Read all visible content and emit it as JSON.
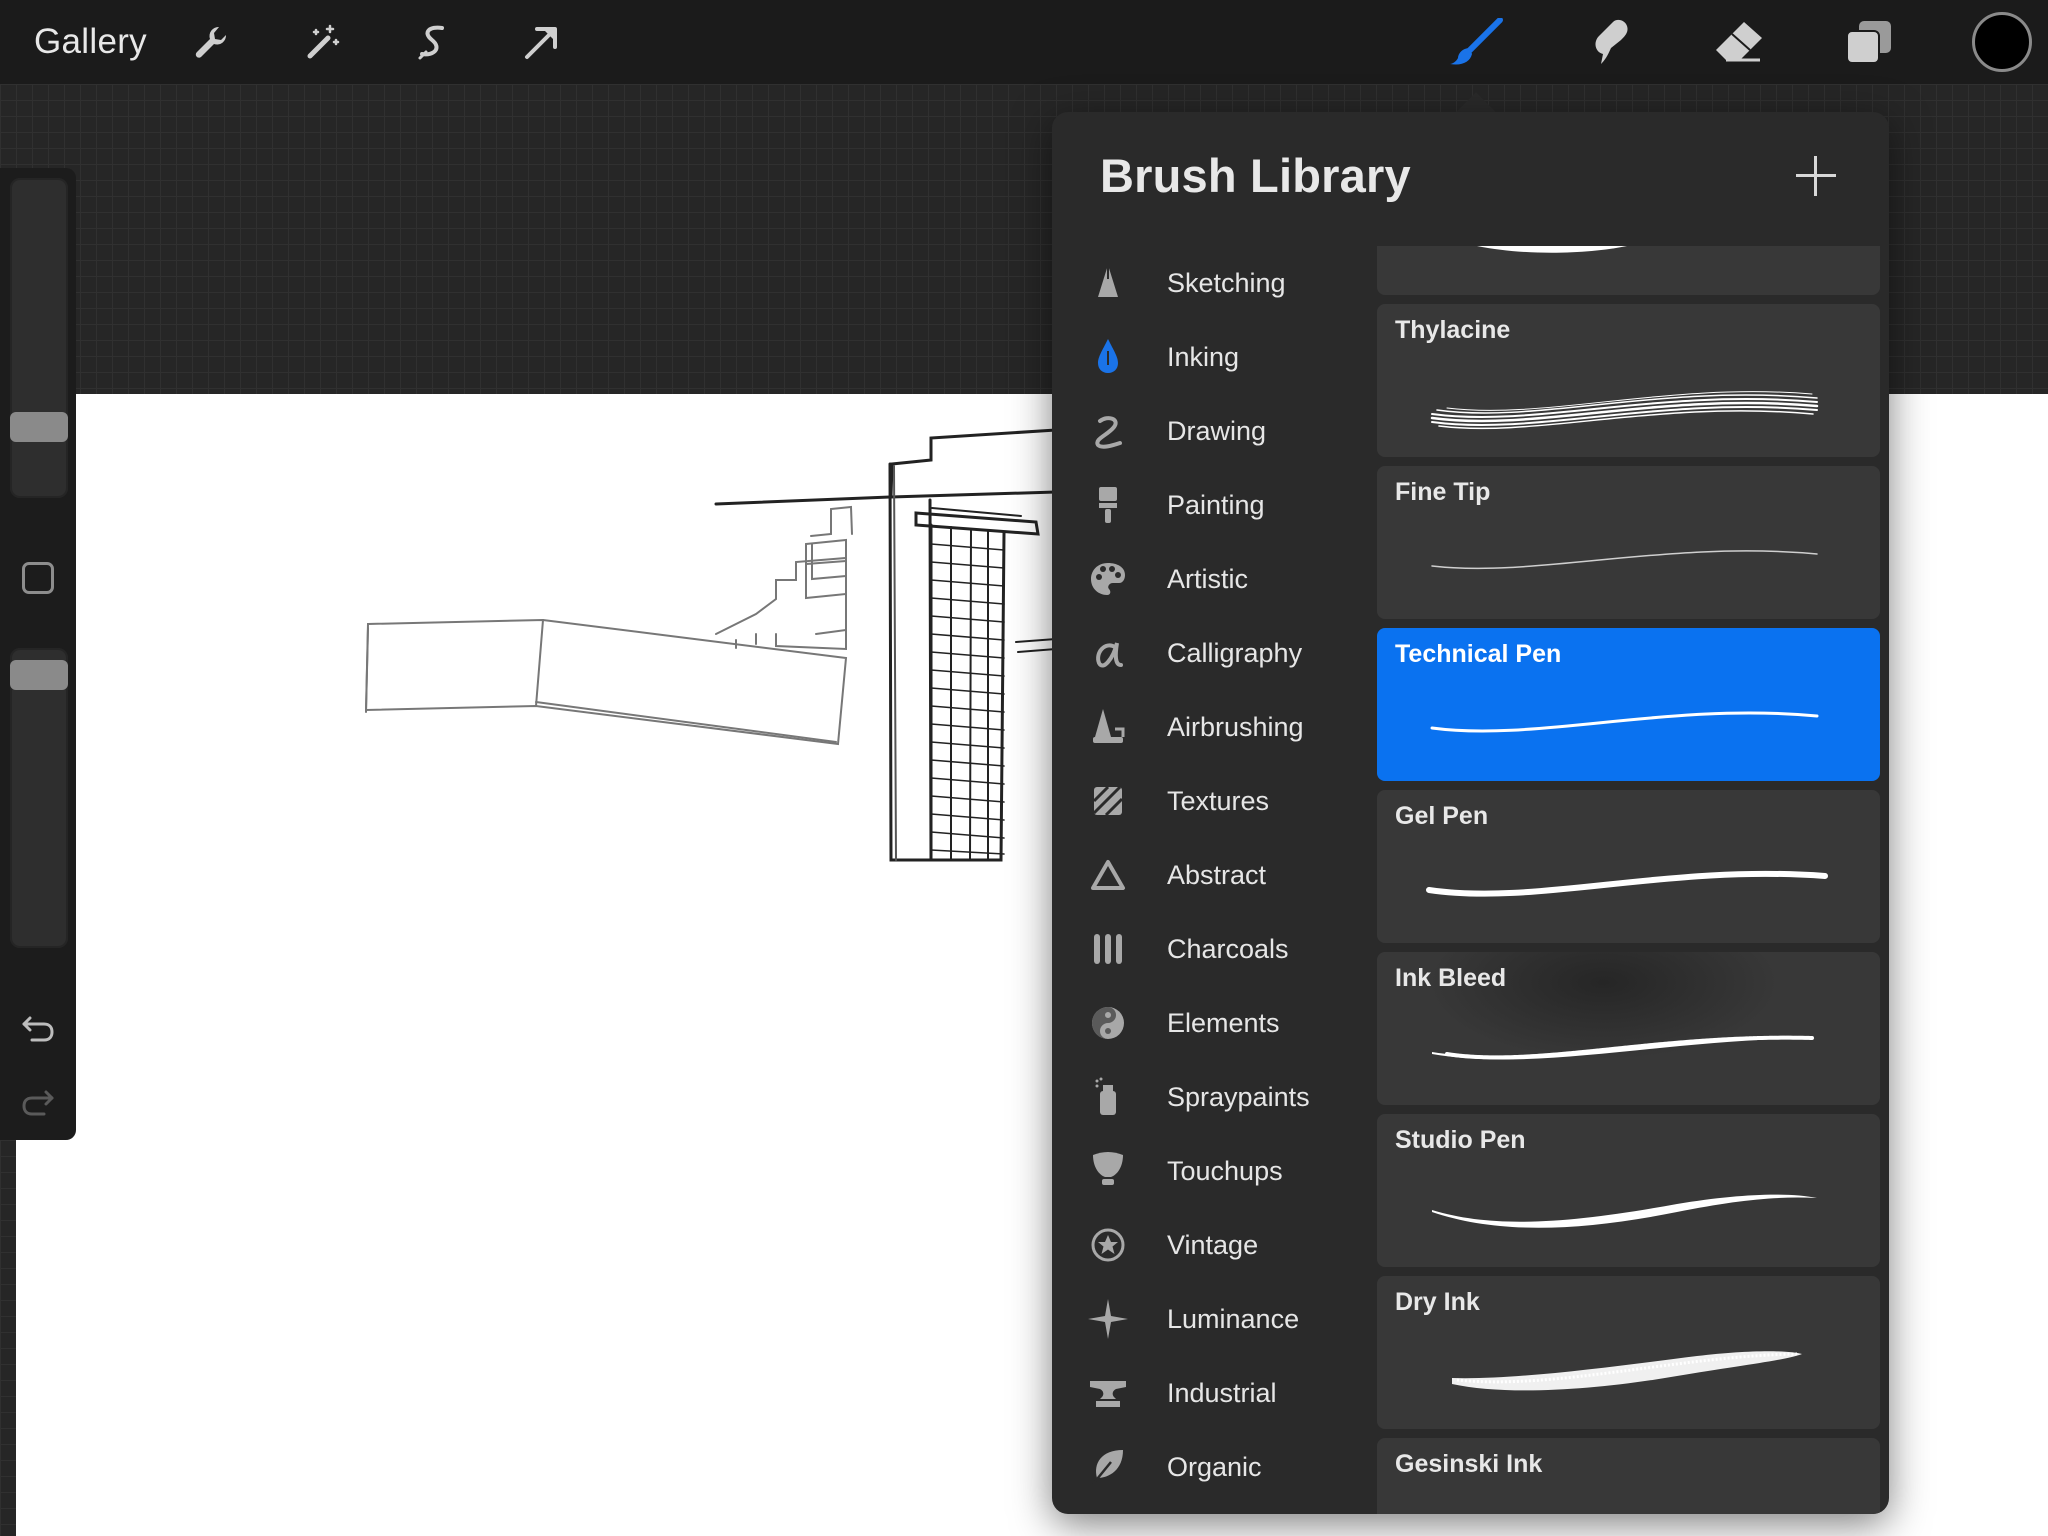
{
  "topbar": {
    "gallery_label": "Gallery",
    "tools": [
      "wrench-icon",
      "magic-wand-icon",
      "selection-icon",
      "move-arrow-icon"
    ],
    "right_tools": [
      "brush-icon",
      "smudge-icon",
      "eraser-icon",
      "layers-icon"
    ],
    "current_color": "#000000",
    "active_tool_color": "#1a73e8"
  },
  "sidebar": {
    "controls": [
      "brush-size-slider",
      "modify-button",
      "opacity-slider",
      "undo-icon",
      "redo-icon"
    ]
  },
  "brush_library": {
    "title": "Brush Library",
    "categories": [
      {
        "label": "Sketching",
        "icon": "sketching-icon"
      },
      {
        "label": "Inking",
        "icon": "inking-icon",
        "active": true
      },
      {
        "label": "Drawing",
        "icon": "drawing-icon"
      },
      {
        "label": "Painting",
        "icon": "painting-icon"
      },
      {
        "label": "Artistic",
        "icon": "palette-icon"
      },
      {
        "label": "Calligraphy",
        "icon": "calligraphy-icon"
      },
      {
        "label": "Airbrushing",
        "icon": "airbrush-icon"
      },
      {
        "label": "Textures",
        "icon": "textures-icon"
      },
      {
        "label": "Abstract",
        "icon": "abstract-icon"
      },
      {
        "label": "Charcoals",
        "icon": "charcoals-icon"
      },
      {
        "label": "Elements",
        "icon": "yin-yang-icon"
      },
      {
        "label": "Spraypaints",
        "icon": "spraypaint-icon"
      },
      {
        "label": "Touchups",
        "icon": "touchups-icon"
      },
      {
        "label": "Vintage",
        "icon": "star-badge-icon"
      },
      {
        "label": "Luminance",
        "icon": "sparkle-icon"
      },
      {
        "label": "Industrial",
        "icon": "anvil-icon"
      },
      {
        "label": "Organic",
        "icon": "leaf-icon"
      }
    ],
    "brushes": [
      {
        "name": "",
        "style": "partial"
      },
      {
        "name": "Thylacine",
        "style": "textured"
      },
      {
        "name": "Fine Tip",
        "style": "thin"
      },
      {
        "name": "Technical Pen",
        "style": "medium",
        "selected": true
      },
      {
        "name": "Gel Pen",
        "style": "bold"
      },
      {
        "name": "Ink Bleed",
        "style": "rough"
      },
      {
        "name": "Studio Pen",
        "style": "tapered"
      },
      {
        "name": "Dry Ink",
        "style": "dry"
      },
      {
        "name": "Gesinski Ink",
        "style": "partial-bottom"
      }
    ]
  }
}
